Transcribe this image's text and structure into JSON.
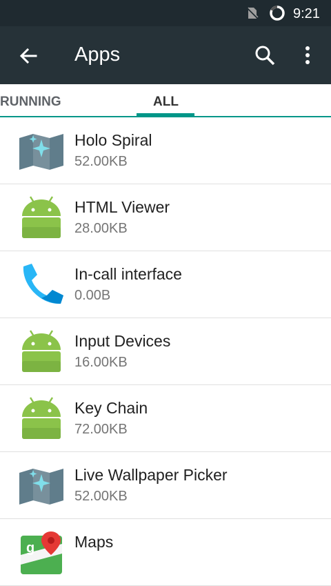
{
  "status_bar": {
    "time": "9:21"
  },
  "toolbar": {
    "title": "Apps"
  },
  "tabs": [
    {
      "label": "RUNNING"
    },
    {
      "label": "ALL",
      "selected": true
    }
  ],
  "apps": [
    {
      "name": "Holo Spiral",
      "size": "52.00KB",
      "icon": "map-sparkle-icon"
    },
    {
      "name": "HTML Viewer",
      "size": "28.00KB",
      "icon": "android-icon"
    },
    {
      "name": "In-call interface",
      "size": "0.00B",
      "icon": "phone-icon"
    },
    {
      "name": "Input Devices",
      "size": "16.00KB",
      "icon": "android-icon"
    },
    {
      "name": "Key Chain",
      "size": "72.00KB",
      "icon": "android-icon"
    },
    {
      "name": "Live Wallpaper Picker",
      "size": "52.00KB",
      "icon": "map-sparkle-icon"
    },
    {
      "name": "Maps",
      "size": "",
      "icon": "google-maps-icon"
    }
  ],
  "colors": {
    "status_bar": "#1f2a30",
    "toolbar": "#263238",
    "tab_accent": "#009688",
    "android_green": "#8bc34a"
  }
}
